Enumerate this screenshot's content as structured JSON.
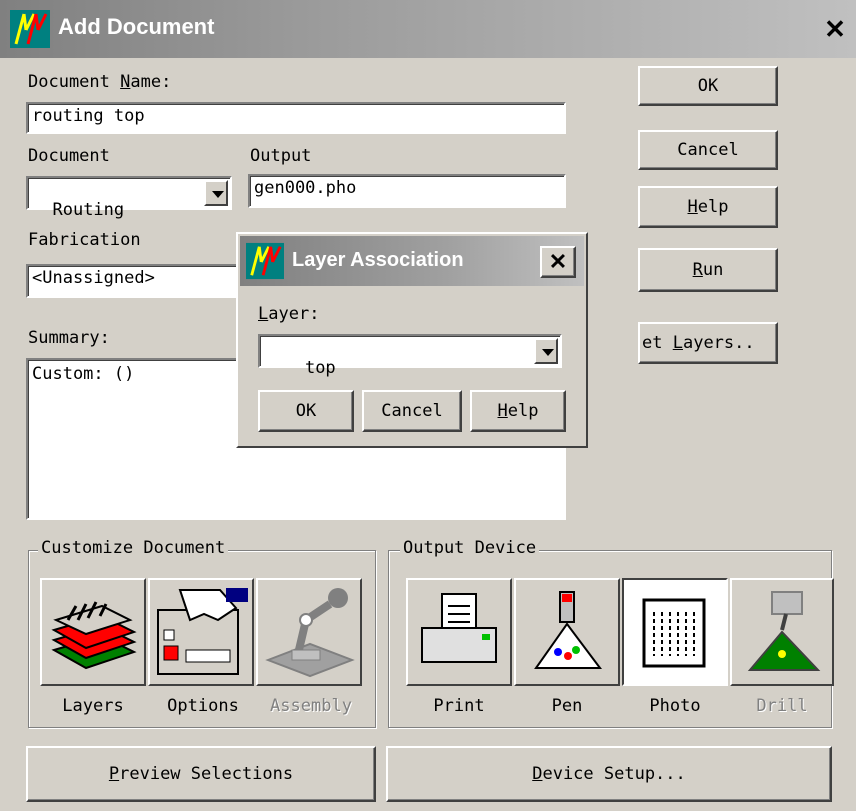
{
  "window": {
    "title": "Add Document",
    "close_label": "✕",
    "app_icon": "app-logo-icon"
  },
  "form": {
    "document_name_label": "Document Name:",
    "document_name_value": "routing top",
    "document_label": "Document",
    "document_value": "Routing",
    "output_label": "Output",
    "output_value": "gen000.pho",
    "fabrication_label": "Fabrication",
    "fabrication_value": "<Unassigned>",
    "summary_label": "Summary:",
    "summary_value": "Custom: ()"
  },
  "side_buttons": {
    "ok": "OK",
    "cancel": "Cancel",
    "help": "Help",
    "run": "Run",
    "set_layers": "et Layers.."
  },
  "customize": {
    "title": "Customize Document",
    "items": [
      {
        "label": "Layers",
        "icon": "layers-icon",
        "enabled": true
      },
      {
        "label": "Options",
        "icon": "options-icon",
        "enabled": true
      },
      {
        "label": "Assembly",
        "icon": "assembly-icon",
        "enabled": false
      }
    ]
  },
  "output_device": {
    "title": "Output Device",
    "items": [
      {
        "label": "Print",
        "icon": "printer-icon",
        "enabled": true
      },
      {
        "label": "Pen",
        "icon": "pen-plotter-icon",
        "enabled": true
      },
      {
        "label": "Photo",
        "icon": "photo-plotter-icon",
        "enabled": true,
        "selected": true
      },
      {
        "label": "Drill",
        "icon": "drill-icon",
        "enabled": false
      }
    ]
  },
  "bottom": {
    "preview": "Preview Selections",
    "device_setup": "Device Setup..."
  },
  "layer_dialog": {
    "title": "Layer Association",
    "close_label": "✕",
    "layer_label": "Layer:",
    "layer_value": "top",
    "ok": "OK",
    "cancel": "Cancel",
    "help": "Help"
  }
}
